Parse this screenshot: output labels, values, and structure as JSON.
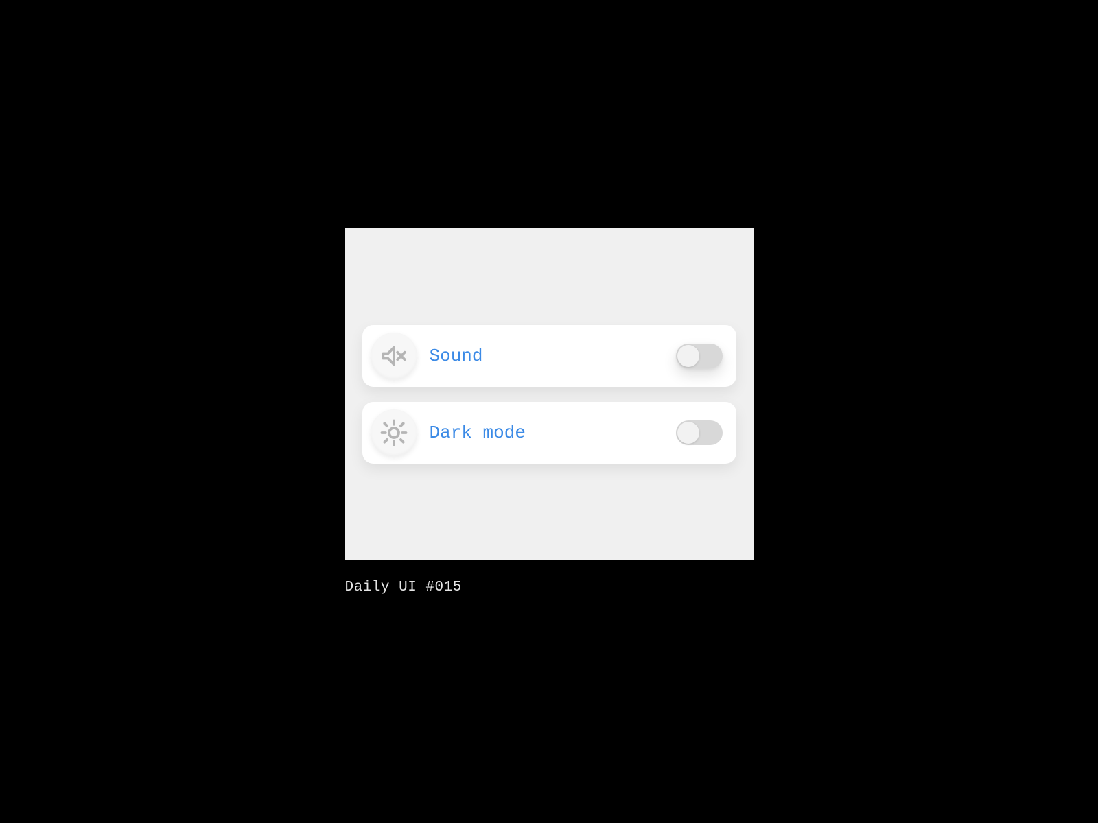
{
  "settings": {
    "sound": {
      "label": "Sound",
      "icon": "volume-mute-icon",
      "toggled": false
    },
    "dark_mode": {
      "label": "Dark mode",
      "icon": "sun-icon",
      "toggled": false
    }
  },
  "caption": "Daily UI #015",
  "colors": {
    "background": "#000000",
    "card": "#f0f0f0",
    "row": "#ffffff",
    "label": "#3b8ae6",
    "icon": "#b5b5b5",
    "toggle_track": "#d8d8d8",
    "toggle_knob": "#f2f2f2"
  }
}
